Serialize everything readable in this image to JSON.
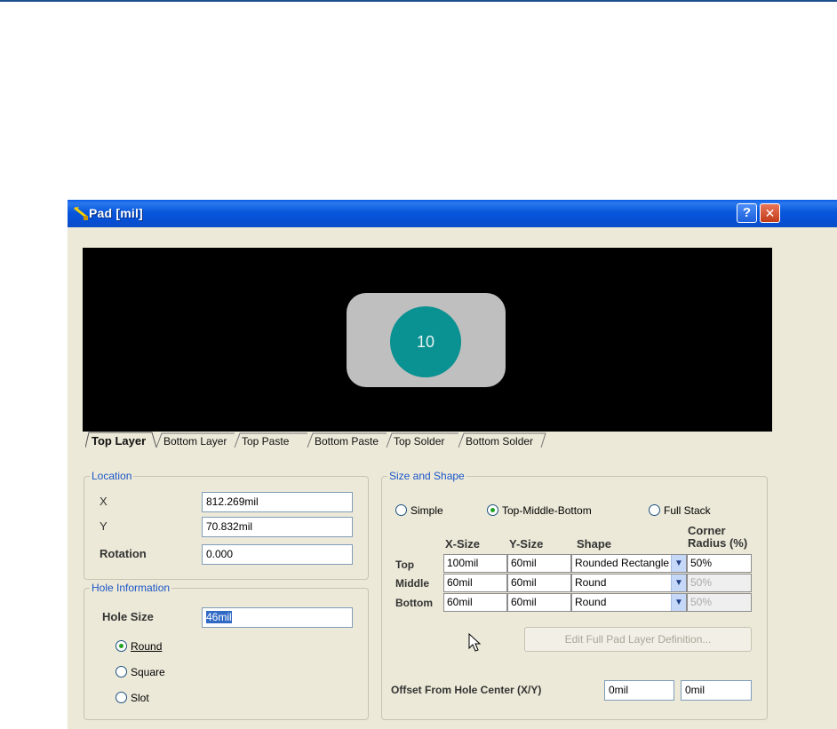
{
  "window": {
    "title": "Pad [mil]",
    "help": "?",
    "close": "✕"
  },
  "preview": {
    "pad_number": "10"
  },
  "tabs": [
    "Top Layer",
    "Bottom Layer",
    "Top Paste",
    "Bottom Paste",
    "Top Solder",
    "Bottom Solder"
  ],
  "location": {
    "legend": "Location",
    "x_label": "X",
    "x_value": "812.269mil",
    "y_label": "Y",
    "y_value": "70.832mil",
    "rotation_label": "Rotation",
    "rotation_value": "0.000"
  },
  "hole": {
    "legend": "Hole Information",
    "size_label": "Hole Size",
    "size_value": "46mil",
    "opt_round": "Round",
    "opt_square": "Square",
    "opt_slot": "Slot",
    "selected": "Round"
  },
  "shape": {
    "legend": "Size and Shape",
    "mode_simple": "Simple",
    "mode_tmb": "Top-Middle-Bottom",
    "mode_full": "Full Stack",
    "selected_mode": "Top-Middle-Bottom",
    "col_xsize": "X-Size",
    "col_ysize": "Y-Size",
    "col_shape": "Shape",
    "col_corner_1": "Corner",
    "col_corner_2": "Radius (%)",
    "rows": [
      {
        "name": "Top",
        "x": "100mil",
        "y": "60mil",
        "shape": "Rounded Rectangle",
        "radius": "50%"
      },
      {
        "name": "Middle",
        "x": "60mil",
        "y": "60mil",
        "shape": "Round",
        "radius": "50%"
      },
      {
        "name": "Bottom",
        "x": "60mil",
        "y": "60mil",
        "shape": "Round",
        "radius": "50%"
      }
    ],
    "edit_button": "Edit Full Pad Layer Definition...",
    "offset_label": "Offset From Hole Center (X/Y)",
    "offset_x": "0mil",
    "offset_y": "0mil"
  },
  "colors": {
    "titlebar": "#0a5de6",
    "legend": "#1b56c8",
    "pad_outline": "#bfbfbf",
    "pad_hole": "#0a9191"
  },
  "icons": [
    "pad-tool-icon",
    "help-icon",
    "close-icon",
    "dropdown-arrow-icon",
    "mouse-pointer-icon"
  ]
}
